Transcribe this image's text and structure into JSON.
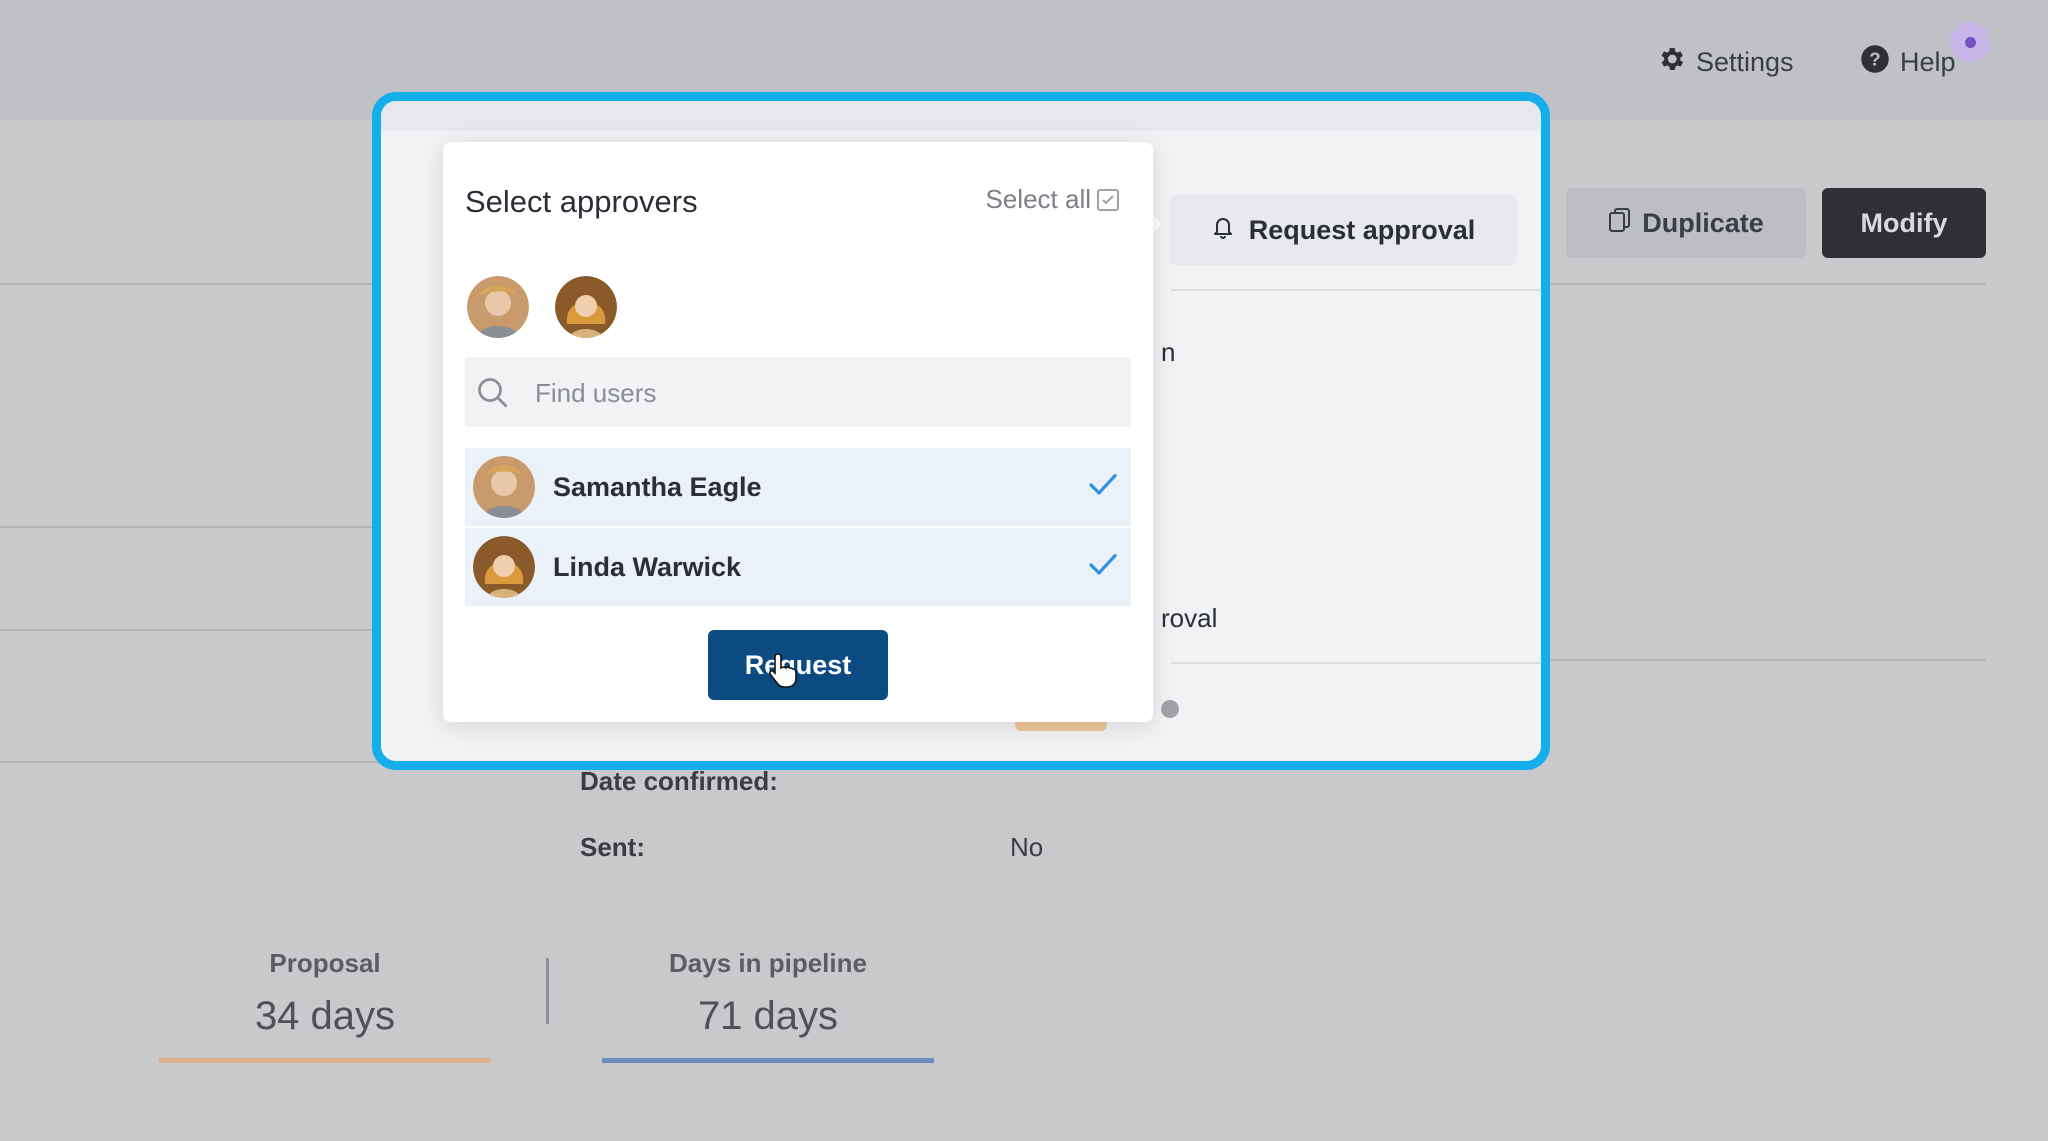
{
  "topbar": {
    "settings_label": "Settings",
    "help_label": "Help",
    "notification_color": "#7b4fc6"
  },
  "actions": {
    "request_approval_label": "Request approval",
    "duplicate_label": "Duplicate",
    "modify_label": "Modify"
  },
  "background_fragments": {
    "frag1": "n",
    "frag2": "roval"
  },
  "details": {
    "date_confirmed_label": "Date confirmed:",
    "sent_label": "Sent:",
    "sent_value": "No"
  },
  "stats": [
    {
      "label": "Proposal",
      "value": "34 days",
      "bar_color": "#e0b08a"
    },
    {
      "label": "Days in pipeline",
      "value": "71 days",
      "bar_color": "#6c8fbd"
    }
  ],
  "popover": {
    "title": "Select approvers",
    "select_all_label": "Select all",
    "search_placeholder": "Find users",
    "users": [
      {
        "name": "Samantha Eagle",
        "selected": true
      },
      {
        "name": "Linda Warwick",
        "selected": true
      }
    ],
    "request_button_label": "Request"
  },
  "colors": {
    "highlight": "#14aeea",
    "primary_button": "#0c4a82",
    "check": "#2f8fe0"
  }
}
